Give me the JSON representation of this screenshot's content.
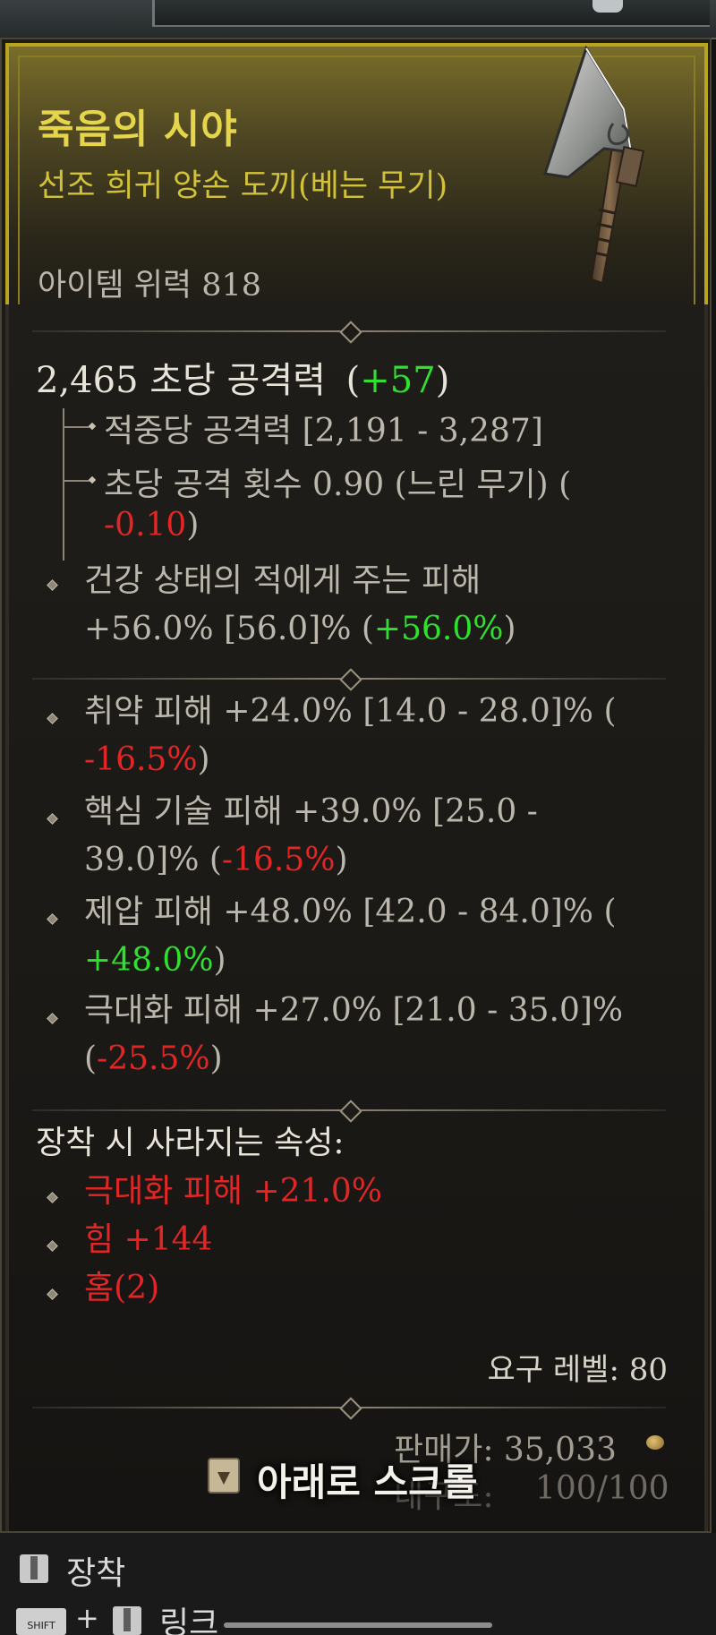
{
  "item": {
    "name": "죽음의 시야",
    "type": "선조 희귀 양손 도끼(베는 무기)",
    "power": "아이템 위력 818"
  },
  "dps": {
    "value": "2,465 초당 공격력",
    "delta_open": "(",
    "delta": "+57",
    "delta_close": ")"
  },
  "damage_per_hit": "적중당 공격력 [2,191 - 3,287]",
  "attacks_per_second": {
    "text": "초당 공격 횟수 0.90 (느린 무기) (",
    "delta": "-0.10",
    "close": ")"
  },
  "implicit": {
    "line1": "건강 상태의 적에게 주는 피해",
    "line2": "+56.0% [56.0]% (",
    "delta": "+56.0%",
    "close": ")"
  },
  "affixes": [
    {
      "line1": "취약 피해 +24.0% [14.0 - 28.0]% (",
      "line2_prefix": "",
      "delta": "-16.5%",
      "close": ")",
      "delta_color": "red"
    },
    {
      "line1": "핵심 기술 피해 +39.0% [25.0 -",
      "line2_prefix": "39.0]% (",
      "delta": "-16.5%",
      "close": ")",
      "delta_color": "red"
    },
    {
      "line1": "제압 피해 +48.0% [42.0 - 84.0]% (",
      "line2_prefix": "",
      "delta": "+48.0%",
      "close": ")",
      "delta_color": "green"
    },
    {
      "line1": "극대화 피해 +27.0% [21.0 - 35.0]%",
      "line2_prefix": "(",
      "delta": "-25.5%",
      "close": ")",
      "delta_color": "red"
    }
  ],
  "lost_properties": {
    "header": "장착 시 사라지는 속성:",
    "items": [
      "극대화 피해 +21.0%",
      "힘 +144",
      "홈(2)"
    ]
  },
  "requirements": {
    "level": "요구 레벨: 80"
  },
  "sell_value": "판매가: 35,033",
  "durability": {
    "label": "내구도:",
    "value": "100/100"
  },
  "scroll_hint": "아래로 스크롤",
  "footer": {
    "equip": "장착",
    "shift_key": "SHIFT",
    "plus": "+",
    "link": "링크"
  },
  "colors": {
    "legendary_gold": "#e4d54a",
    "positive": "#2fe02f",
    "negative": "#e22626"
  },
  "icons": [
    "two-handed-axe-icon",
    "mouse-button-icon",
    "gold-coin-icon",
    "scroll-down-icon"
  ]
}
